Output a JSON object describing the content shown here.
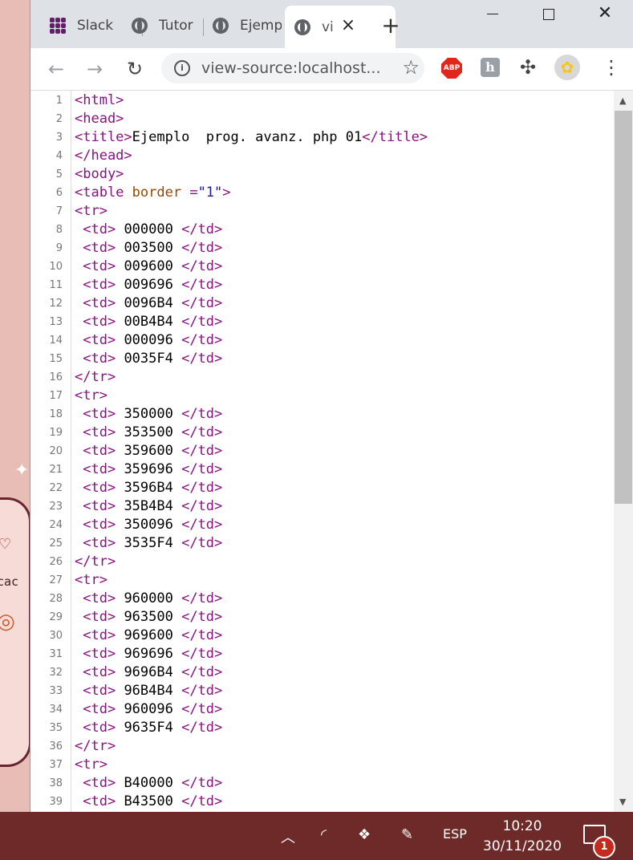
{
  "browser": {
    "tabs": [
      {
        "title": "Slack",
        "icon": "slack-icon"
      },
      {
        "title": "Tutor",
        "icon": "globe-icon"
      },
      {
        "title": "Ejemp",
        "icon": "globe-icon"
      },
      {
        "title": "vi",
        "icon": "globe-icon",
        "active": true
      }
    ],
    "new_tab_label": "+",
    "url": "view-source:localhost...",
    "extensions": {
      "adblock_label": "ABP",
      "honey_label": "h"
    }
  },
  "source_lines": [
    [
      {
        "t": "tag",
        "v": "<html>"
      }
    ],
    [
      {
        "t": "tag",
        "v": "<head>"
      }
    ],
    [
      {
        "t": "tag",
        "v": "<title>"
      },
      {
        "t": "text",
        "v": "Ejemplo  prog. avanz. php 01"
      },
      {
        "t": "tag",
        "v": "</title>"
      }
    ],
    [
      {
        "t": "tag",
        "v": "</head>"
      }
    ],
    [
      {
        "t": "tag",
        "v": "<body>"
      }
    ],
    [
      {
        "t": "tag",
        "v": "<table "
      },
      {
        "t": "attr",
        "v": "border"
      },
      {
        "t": "tag",
        "v": " ="
      },
      {
        "t": "val",
        "v": "\"1\""
      },
      {
        "t": "tag",
        "v": ">"
      }
    ],
    [
      {
        "t": "tag",
        "v": "<tr>"
      }
    ],
    [
      {
        "t": "text",
        "v": " "
      },
      {
        "t": "tag",
        "v": "<td>"
      },
      {
        "t": "text",
        "v": " 000000 "
      },
      {
        "t": "tag",
        "v": "</td>"
      }
    ],
    [
      {
        "t": "text",
        "v": " "
      },
      {
        "t": "tag",
        "v": "<td>"
      },
      {
        "t": "text",
        "v": " 003500 "
      },
      {
        "t": "tag",
        "v": "</td>"
      }
    ],
    [
      {
        "t": "text",
        "v": " "
      },
      {
        "t": "tag",
        "v": "<td>"
      },
      {
        "t": "text",
        "v": " 009600 "
      },
      {
        "t": "tag",
        "v": "</td>"
      }
    ],
    [
      {
        "t": "text",
        "v": " "
      },
      {
        "t": "tag",
        "v": "<td>"
      },
      {
        "t": "text",
        "v": " 009696 "
      },
      {
        "t": "tag",
        "v": "</td>"
      }
    ],
    [
      {
        "t": "text",
        "v": " "
      },
      {
        "t": "tag",
        "v": "<td>"
      },
      {
        "t": "text",
        "v": " 0096B4 "
      },
      {
        "t": "tag",
        "v": "</td>"
      }
    ],
    [
      {
        "t": "text",
        "v": " "
      },
      {
        "t": "tag",
        "v": "<td>"
      },
      {
        "t": "text",
        "v": " 00B4B4 "
      },
      {
        "t": "tag",
        "v": "</td>"
      }
    ],
    [
      {
        "t": "text",
        "v": " "
      },
      {
        "t": "tag",
        "v": "<td>"
      },
      {
        "t": "text",
        "v": " 000096 "
      },
      {
        "t": "tag",
        "v": "</td>"
      }
    ],
    [
      {
        "t": "text",
        "v": " "
      },
      {
        "t": "tag",
        "v": "<td>"
      },
      {
        "t": "text",
        "v": " 0035F4 "
      },
      {
        "t": "tag",
        "v": "</td>"
      }
    ],
    [
      {
        "t": "tag",
        "v": "</tr>"
      }
    ],
    [
      {
        "t": "tag",
        "v": "<tr>"
      }
    ],
    [
      {
        "t": "text",
        "v": " "
      },
      {
        "t": "tag",
        "v": "<td>"
      },
      {
        "t": "text",
        "v": " 350000 "
      },
      {
        "t": "tag",
        "v": "</td>"
      }
    ],
    [
      {
        "t": "text",
        "v": " "
      },
      {
        "t": "tag",
        "v": "<td>"
      },
      {
        "t": "text",
        "v": " 353500 "
      },
      {
        "t": "tag",
        "v": "</td>"
      }
    ],
    [
      {
        "t": "text",
        "v": " "
      },
      {
        "t": "tag",
        "v": "<td>"
      },
      {
        "t": "text",
        "v": " 359600 "
      },
      {
        "t": "tag",
        "v": "</td>"
      }
    ],
    [
      {
        "t": "text",
        "v": " "
      },
      {
        "t": "tag",
        "v": "<td>"
      },
      {
        "t": "text",
        "v": " 359696 "
      },
      {
        "t": "tag",
        "v": "</td>"
      }
    ],
    [
      {
        "t": "text",
        "v": " "
      },
      {
        "t": "tag",
        "v": "<td>"
      },
      {
        "t": "text",
        "v": " 3596B4 "
      },
      {
        "t": "tag",
        "v": "</td>"
      }
    ],
    [
      {
        "t": "text",
        "v": " "
      },
      {
        "t": "tag",
        "v": "<td>"
      },
      {
        "t": "text",
        "v": " 35B4B4 "
      },
      {
        "t": "tag",
        "v": "</td>"
      }
    ],
    [
      {
        "t": "text",
        "v": " "
      },
      {
        "t": "tag",
        "v": "<td>"
      },
      {
        "t": "text",
        "v": " 350096 "
      },
      {
        "t": "tag",
        "v": "</td>"
      }
    ],
    [
      {
        "t": "text",
        "v": " "
      },
      {
        "t": "tag",
        "v": "<td>"
      },
      {
        "t": "text",
        "v": " 3535F4 "
      },
      {
        "t": "tag",
        "v": "</td>"
      }
    ],
    [
      {
        "t": "tag",
        "v": "</tr>"
      }
    ],
    [
      {
        "t": "tag",
        "v": "<tr>"
      }
    ],
    [
      {
        "t": "text",
        "v": " "
      },
      {
        "t": "tag",
        "v": "<td>"
      },
      {
        "t": "text",
        "v": " 960000 "
      },
      {
        "t": "tag",
        "v": "</td>"
      }
    ],
    [
      {
        "t": "text",
        "v": " "
      },
      {
        "t": "tag",
        "v": "<td>"
      },
      {
        "t": "text",
        "v": " 963500 "
      },
      {
        "t": "tag",
        "v": "</td>"
      }
    ],
    [
      {
        "t": "text",
        "v": " "
      },
      {
        "t": "tag",
        "v": "<td>"
      },
      {
        "t": "text",
        "v": " 969600 "
      },
      {
        "t": "tag",
        "v": "</td>"
      }
    ],
    [
      {
        "t": "text",
        "v": " "
      },
      {
        "t": "tag",
        "v": "<td>"
      },
      {
        "t": "text",
        "v": " 969696 "
      },
      {
        "t": "tag",
        "v": "</td>"
      }
    ],
    [
      {
        "t": "text",
        "v": " "
      },
      {
        "t": "tag",
        "v": "<td>"
      },
      {
        "t": "text",
        "v": " 9696B4 "
      },
      {
        "t": "tag",
        "v": "</td>"
      }
    ],
    [
      {
        "t": "text",
        "v": " "
      },
      {
        "t": "tag",
        "v": "<td>"
      },
      {
        "t": "text",
        "v": " 96B4B4 "
      },
      {
        "t": "tag",
        "v": "</td>"
      }
    ],
    [
      {
        "t": "text",
        "v": " "
      },
      {
        "t": "tag",
        "v": "<td>"
      },
      {
        "t": "text",
        "v": " 960096 "
      },
      {
        "t": "tag",
        "v": "</td>"
      }
    ],
    [
      {
        "t": "text",
        "v": " "
      },
      {
        "t": "tag",
        "v": "<td>"
      },
      {
        "t": "text",
        "v": " 9635F4 "
      },
      {
        "t": "tag",
        "v": "</td>"
      }
    ],
    [
      {
        "t": "tag",
        "v": "</tr>"
      }
    ],
    [
      {
        "t": "tag",
        "v": "<tr>"
      }
    ],
    [
      {
        "t": "text",
        "v": " "
      },
      {
        "t": "tag",
        "v": "<td>"
      },
      {
        "t": "text",
        "v": " B40000 "
      },
      {
        "t": "tag",
        "v": "</td>"
      }
    ],
    [
      {
        "t": "text",
        "v": " "
      },
      {
        "t": "tag",
        "v": "<td>"
      },
      {
        "t": "text",
        "v": " B43500 "
      },
      {
        "t": "tag",
        "v": "</td>"
      }
    ]
  ],
  "taskbar": {
    "language": "ESP",
    "time": "10:20",
    "date": "30/11/2020",
    "notification_count": "1"
  },
  "wallpaper_text": "cac"
}
